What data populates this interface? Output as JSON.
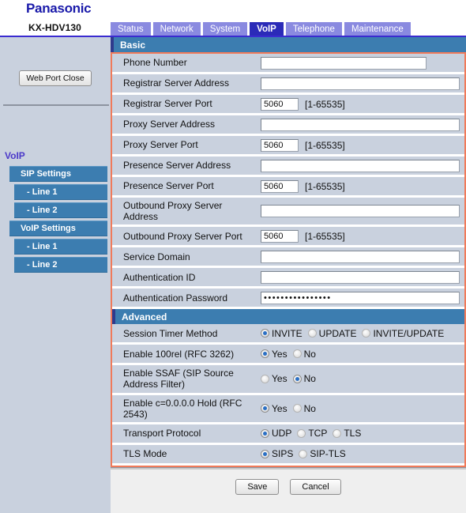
{
  "brand": {
    "logo": "Panasonic",
    "model": "KX-HDV130"
  },
  "tabs": [
    {
      "label": "Status",
      "active": false
    },
    {
      "label": "Network",
      "active": false
    },
    {
      "label": "System",
      "active": false
    },
    {
      "label": "VoIP",
      "active": true
    },
    {
      "label": "Telephone",
      "active": false
    },
    {
      "label": "Maintenance",
      "active": false
    }
  ],
  "sidebar": {
    "web_port_close": "Web Port Close",
    "heading": "VoIP",
    "items": [
      {
        "label": "SIP Settings",
        "level": 1
      },
      {
        "label": "- Line 1",
        "level": 2
      },
      {
        "label": "- Line 2",
        "level": 2
      },
      {
        "label": "VoIP Settings",
        "level": 1
      },
      {
        "label": "- Line 1",
        "level": 2
      },
      {
        "label": "- Line 2",
        "level": 2
      }
    ]
  },
  "basic": {
    "title": "Basic",
    "rows": [
      {
        "label": "Phone Number",
        "value": "",
        "hint": ""
      },
      {
        "label": "Registrar Server Address",
        "value": "",
        "hint": ""
      },
      {
        "label": "Registrar Server Port",
        "value": "5060",
        "hint": "[1-65535]"
      },
      {
        "label": "Proxy Server Address",
        "value": "",
        "hint": ""
      },
      {
        "label": "Proxy Server Port",
        "value": "5060",
        "hint": "[1-65535]"
      },
      {
        "label": "Presence Server Address",
        "value": "",
        "hint": ""
      },
      {
        "label": "Presence Server Port",
        "value": "5060",
        "hint": "[1-65535]"
      },
      {
        "label": "Outbound Proxy Server Address",
        "value": "",
        "hint": ""
      },
      {
        "label": "Outbound Proxy Server Port",
        "value": "5060",
        "hint": "[1-65535]"
      },
      {
        "label": "Service Domain",
        "value": "",
        "hint": ""
      },
      {
        "label": "Authentication ID",
        "value": "",
        "hint": ""
      },
      {
        "label": "Authentication Password",
        "value": "••••••••••••••••",
        "hint": ""
      }
    ]
  },
  "advanced": {
    "title": "Advanced",
    "rows": [
      {
        "label": "Session Timer Method",
        "options": [
          {
            "label": "INVITE",
            "selected": true
          },
          {
            "label": "UPDATE",
            "selected": false
          },
          {
            "label": "INVITE/UPDATE",
            "selected": false
          }
        ]
      },
      {
        "label": "Enable 100rel (RFC 3262)",
        "options": [
          {
            "label": "Yes",
            "selected": true
          },
          {
            "label": "No",
            "selected": false
          }
        ]
      },
      {
        "label": "Enable SSAF (SIP Source Address Filter)",
        "options": [
          {
            "label": "Yes",
            "selected": false
          },
          {
            "label": "No",
            "selected": true
          }
        ]
      },
      {
        "label": "Enable c=0.0.0.0 Hold (RFC 2543)",
        "options": [
          {
            "label": "Yes",
            "selected": true
          },
          {
            "label": "No",
            "selected": false
          }
        ]
      },
      {
        "label": "Transport Protocol",
        "options": [
          {
            "label": "UDP",
            "selected": true
          },
          {
            "label": "TCP",
            "selected": false
          },
          {
            "label": "TLS",
            "selected": false
          }
        ]
      },
      {
        "label": "TLS Mode",
        "options": [
          {
            "label": "SIPS",
            "selected": true
          },
          {
            "label": "SIP-TLS",
            "selected": false
          }
        ]
      }
    ]
  },
  "footer": {
    "save": "Save",
    "cancel": "Cancel"
  },
  "colors": {
    "accent_blue": "#3c7db0",
    "tab_inactive": "#8a8ae0",
    "tab_active": "#2b2bb8",
    "frame_orange": "#f07a5a",
    "sidebar_bg": "#c9d1de",
    "logo_blue": "#1a1aaa",
    "heading_purple": "#4b39c9"
  }
}
